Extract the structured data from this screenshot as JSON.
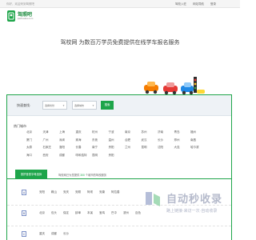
{
  "topbar": {
    "greeting": "你好，欢迎来到驾照吧",
    "links": [
      "驾校入驻",
      "网站导航",
      "登录"
    ]
  },
  "brand": {
    "name": "驾照吧",
    "url": "jiazhaoba.com"
  },
  "slogan": "驾校网 为数百万学员免费提供在线学车报名服务",
  "search": {
    "label": "快速查找:",
    "province": "选择省份",
    "city": "选择城市",
    "button": "搜索"
  },
  "hot": {
    "title": "热门城市",
    "cities": [
      "北京",
      "天津",
      "上海",
      "重庆",
      "杭州",
      "宁波",
      "南京",
      "苏州",
      "济南",
      "青岛",
      "福州",
      "厦门",
      "广州",
      "深圳",
      "珠海",
      "东莞",
      "温州",
      "合肥",
      "武汉",
      "长沙",
      "郑州",
      "南昌",
      "太原",
      "石家庄",
      "洛阳",
      "长春",
      "南宁",
      "贵阳",
      "兰州",
      "昆明",
      "沈阳",
      "大连",
      "哈尔滨",
      "海口",
      "西安",
      "成都",
      "呼和浩特",
      "昆明",
      "贵阳"
    ]
  },
  "tabs": {
    "active": "按拼音首字母选择",
    "note_prefix": "驾校网已为您提供",
    "note_count": "300",
    "note_suffix": "个城市的驾校服务"
  },
  "letters": [
    {
      "letter": "A",
      "cities": [
        "安阳",
        "鞍山",
        "安庆",
        "安顺",
        "阿坝",
        "安康",
        "阿拉善"
      ]
    },
    {
      "letter": "B",
      "cities": [
        "北京",
        "包头",
        "保定",
        "蚌埠",
        "本溪",
        "宝鸡",
        "巴中",
        "滨州",
        "百色"
      ]
    },
    {
      "letter": "C",
      "cities": [
        "重庆",
        "成都",
        "长沙"
      ]
    }
  ],
  "watermark": {
    "big": "自动秒收录",
    "small": "路上链接·来访一次·自动收录"
  },
  "colors": {
    "accent": "#1ea54a",
    "letter_border": "#7a8fc6"
  }
}
